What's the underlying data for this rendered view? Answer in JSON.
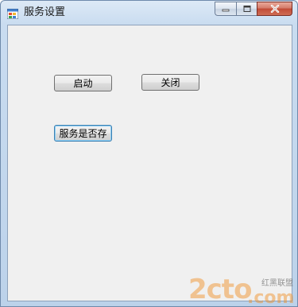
{
  "window": {
    "title": "服务设置",
    "icon": "winforms-app-icon",
    "controls": {
      "minimize_icon": "minimize-icon",
      "maximize_icon": "maximize-icon",
      "close_icon": "close-icon"
    }
  },
  "buttons": {
    "start": "启动",
    "stop": "关闭",
    "check": "服务是否存"
  },
  "watermark": {
    "brand": "2cto",
    "domain": ".com",
    "tagline": "红黑联盟"
  },
  "colors": {
    "close_button": "#c14b36",
    "focus_border": "#3c7fb1",
    "watermark_orange": "#f08c1e"
  }
}
